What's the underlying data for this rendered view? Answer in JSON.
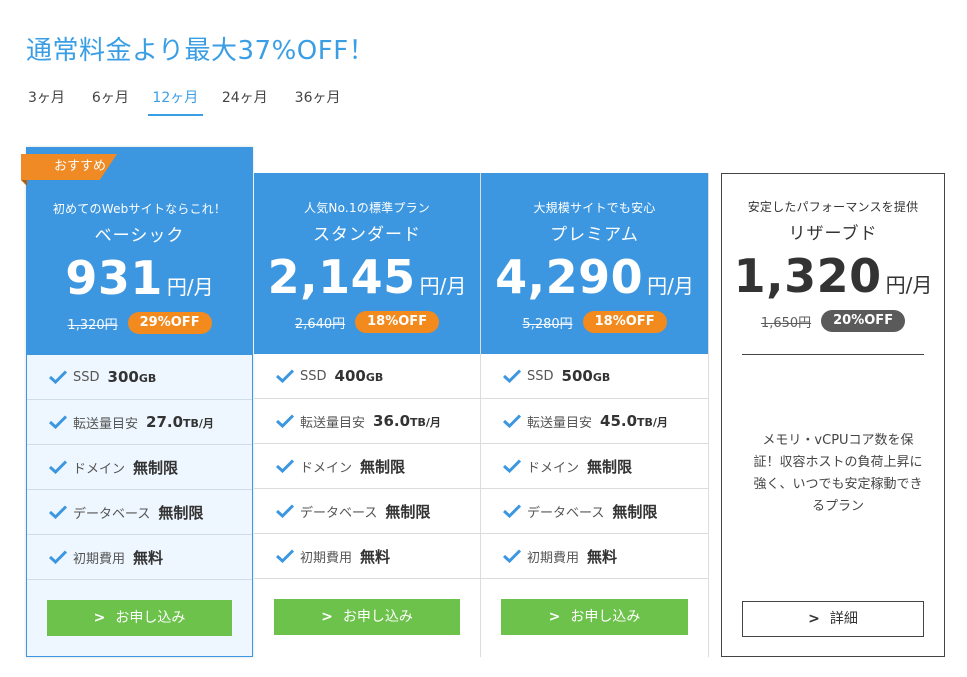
{
  "headline": "通常料金より最大37%OFF！",
  "tabs": [
    "3ヶ月",
    "6ヶ月",
    "12ヶ月",
    "24ヶ月",
    "36ヶ月"
  ],
  "active_tab": "12ヶ月",
  "colors": {
    "accent": "#3d97e0",
    "orange": "#f28a1e",
    "green": "#6cc24a",
    "dark_badge": "#5a5a5a"
  },
  "plans": [
    {
      "badge": "おすすめ",
      "tagline": "初めてのWebサイトならこれ！",
      "name": "ベーシック",
      "price": "931",
      "unit": "円/月",
      "old_price": "1,320円",
      "discount": "29%OFF",
      "features": [
        {
          "label": "SSD",
          "value": "300",
          "unit": "GB"
        },
        {
          "label": "転送量目安",
          "value": "27.0",
          "unit": "TB/月"
        },
        {
          "label": "ドメイン",
          "value": "無制限",
          "unit": ""
        },
        {
          "label": "データベース",
          "value": "無制限",
          "unit": ""
        },
        {
          "label": "初期費用",
          "value": "無料",
          "unit": ""
        }
      ],
      "button": "お申し込み"
    },
    {
      "tagline": "人気No.1の標準プラン",
      "name": "スタンダード",
      "price": "2,145",
      "unit": "円/月",
      "old_price": "2,640円",
      "discount": "18%OFF",
      "features": [
        {
          "label": "SSD",
          "value": "400",
          "unit": "GB"
        },
        {
          "label": "転送量目安",
          "value": "36.0",
          "unit": "TB/月"
        },
        {
          "label": "ドメイン",
          "value": "無制限",
          "unit": ""
        },
        {
          "label": "データベース",
          "value": "無制限",
          "unit": ""
        },
        {
          "label": "初期費用",
          "value": "無料",
          "unit": ""
        }
      ],
      "button": "お申し込み"
    },
    {
      "tagline": "大規模サイトでも安心",
      "name": "プレミアム",
      "price": "4,290",
      "unit": "円/月",
      "old_price": "5,280円",
      "discount": "18%OFF",
      "features": [
        {
          "label": "SSD",
          "value": "500",
          "unit": "GB"
        },
        {
          "label": "転送量目安",
          "value": "45.0",
          "unit": "TB/月"
        },
        {
          "label": "ドメイン",
          "value": "無制限",
          "unit": ""
        },
        {
          "label": "データベース",
          "value": "無制限",
          "unit": ""
        },
        {
          "label": "初期費用",
          "value": "無料",
          "unit": ""
        }
      ],
      "button": "お申し込み"
    }
  ],
  "reserve": {
    "tagline": "安定したパフォーマンスを提供",
    "name": "リザーブド",
    "price": "1,320",
    "unit": "円/月",
    "old_price": "1,650円",
    "discount": "20%OFF",
    "description": "メモリ・vCPUコア数を保証！収容ホストの負荷上昇に強く、いつでも安定稼動できるプラン",
    "button": "詳細"
  },
  "icons": {
    "feature": "check-icon",
    "button": "chevron-right-icon"
  }
}
